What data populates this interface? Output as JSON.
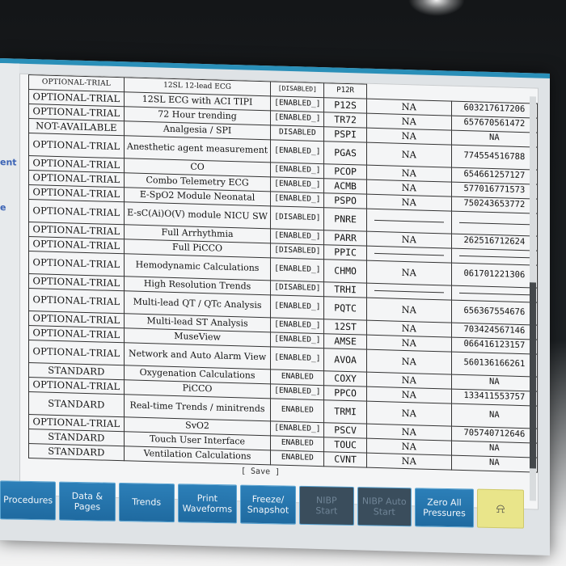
{
  "left_fragments": [
    "ent",
    "e"
  ],
  "partial_top_row": {
    "status": "OPTIONAL-TRIAL",
    "feature": "12SL 12-lead ECG",
    "state": "[DISABLED]",
    "code": "P12R"
  },
  "options": [
    {
      "status": "OPTIONAL-TRIAL",
      "feature": "12SL ECG with ACI TIPI",
      "state": "[ENABLED_]",
      "code": "P12S",
      "na": "NA",
      "number": "603217617206"
    },
    {
      "status": "OPTIONAL-TRIAL",
      "feature": "72 Hour trending",
      "state": "[ENABLED_]",
      "code": "TR72",
      "na": "NA",
      "number": "657670561472"
    },
    {
      "status": "NOT-AVAILABLE",
      "feature": "Analgesia / SPI",
      "state": "DISABLED",
      "code": "PSPI",
      "na": "NA",
      "number": "NA"
    },
    {
      "status": "OPTIONAL-TRIAL",
      "feature": "Anesthetic agent measurement",
      "state": "[ENABLED_]",
      "code": "PGAS",
      "na": "NA",
      "number": "774554516788"
    },
    {
      "status": "OPTIONAL-TRIAL",
      "feature": "CO",
      "state": "[ENABLED_]",
      "code": "PCOP",
      "na": "NA",
      "number": "654661257127"
    },
    {
      "status": "OPTIONAL-TRIAL",
      "feature": "Combo Telemetry ECG",
      "state": "[ENABLED_]",
      "code": "ACMB",
      "na": "NA",
      "number": "577016771573"
    },
    {
      "status": "OPTIONAL-TRIAL",
      "feature": "E-SpO2 Module Neonatal",
      "state": "[ENABLED_]",
      "code": "PSPO",
      "na": "NA",
      "number": "750243653772"
    },
    {
      "status": "OPTIONAL-TRIAL",
      "feature": "E-sC(Ai)O(V) module NICU SW",
      "state": "[DISABLED]",
      "code": "PNRE",
      "na": "",
      "number": ""
    },
    {
      "status": "OPTIONAL-TRIAL",
      "feature": "Full Arrhythmia",
      "state": "[ENABLED_]",
      "code": "PARR",
      "na": "NA",
      "number": "262516712624"
    },
    {
      "status": "OPTIONAL-TRIAL",
      "feature": "Full PiCCO",
      "state": "[DISABLED]",
      "code": "PPIC",
      "na": "",
      "number": ""
    },
    {
      "status": "OPTIONAL-TRIAL",
      "feature": "Hemodynamic Calculations",
      "state": "[ENABLED_]",
      "code": "CHMO",
      "na": "NA",
      "number": "061701221306"
    },
    {
      "status": "OPTIONAL-TRIAL",
      "feature": "High Resolution Trends",
      "state": "[DISABLED]",
      "code": "TRHI",
      "na": "",
      "number": ""
    },
    {
      "status": "OPTIONAL-TRIAL",
      "feature": "Multi-lead QT / QTc Analysis",
      "state": "[ENABLED_]",
      "code": "PQTC",
      "na": "NA",
      "number": "656367554676"
    },
    {
      "status": "OPTIONAL-TRIAL",
      "feature": "Multi-lead ST Analysis",
      "state": "[ENABLED_]",
      "code": "12ST",
      "na": "NA",
      "number": "703424567146"
    },
    {
      "status": "OPTIONAL-TRIAL",
      "feature": "MuseView",
      "state": "[ENABLED_]",
      "code": "AMSE",
      "na": "NA",
      "number": "066416123157"
    },
    {
      "status": "OPTIONAL-TRIAL",
      "feature": "Network and Auto Alarm View",
      "state": "[ENABLED_]",
      "code": "AVOA",
      "na": "NA",
      "number": "560136166261"
    },
    {
      "status": "STANDARD",
      "feature": "Oxygenation Calculations",
      "state": "ENABLED",
      "code": "COXY",
      "na": "NA",
      "number": "NA"
    },
    {
      "status": "OPTIONAL-TRIAL",
      "feature": "PiCCO",
      "state": "[ENABLED_]",
      "code": "PPCO",
      "na": "NA",
      "number": "133411553757"
    },
    {
      "status": "STANDARD",
      "feature": "Real-time Trends / minitrends",
      "state": "ENABLED",
      "code": "TRMI",
      "na": "NA",
      "number": "NA"
    },
    {
      "status": "OPTIONAL-TRIAL",
      "feature": "SvO2",
      "state": "[ENABLED_]",
      "code": "PSCV",
      "na": "NA",
      "number": "705740712646"
    },
    {
      "status": "STANDARD",
      "feature": "Touch User Interface",
      "state": "ENABLED",
      "code": "TOUC",
      "na": "NA",
      "number": "NA"
    },
    {
      "status": "STANDARD",
      "feature": "Ventilation Calculations",
      "state": "ENABLED",
      "code": "CVNT",
      "na": "NA",
      "number": "NA"
    }
  ],
  "save_label": "[ Save ]",
  "softkeys": [
    {
      "label": "Procedures",
      "enabled": true
    },
    {
      "label": "Data &\nPages",
      "enabled": true
    },
    {
      "label": "Trends",
      "enabled": true
    },
    {
      "label": "Print\nWaveforms",
      "enabled": true
    },
    {
      "label": "Freeze/\nSnapshot",
      "enabled": true
    },
    {
      "label": "NIBP\nStart",
      "enabled": false
    },
    {
      "label": "NIBP Auto\nStart",
      "enabled": false
    },
    {
      "label": "Zero All\nPressures",
      "enabled": true
    },
    {
      "label": "⍾",
      "enabled": true,
      "alarm": true
    }
  ],
  "colors": {
    "softkey": "#2c7fb8",
    "alarm_key": "#e9e58a",
    "frame_accent": "#2a8fb8"
  }
}
